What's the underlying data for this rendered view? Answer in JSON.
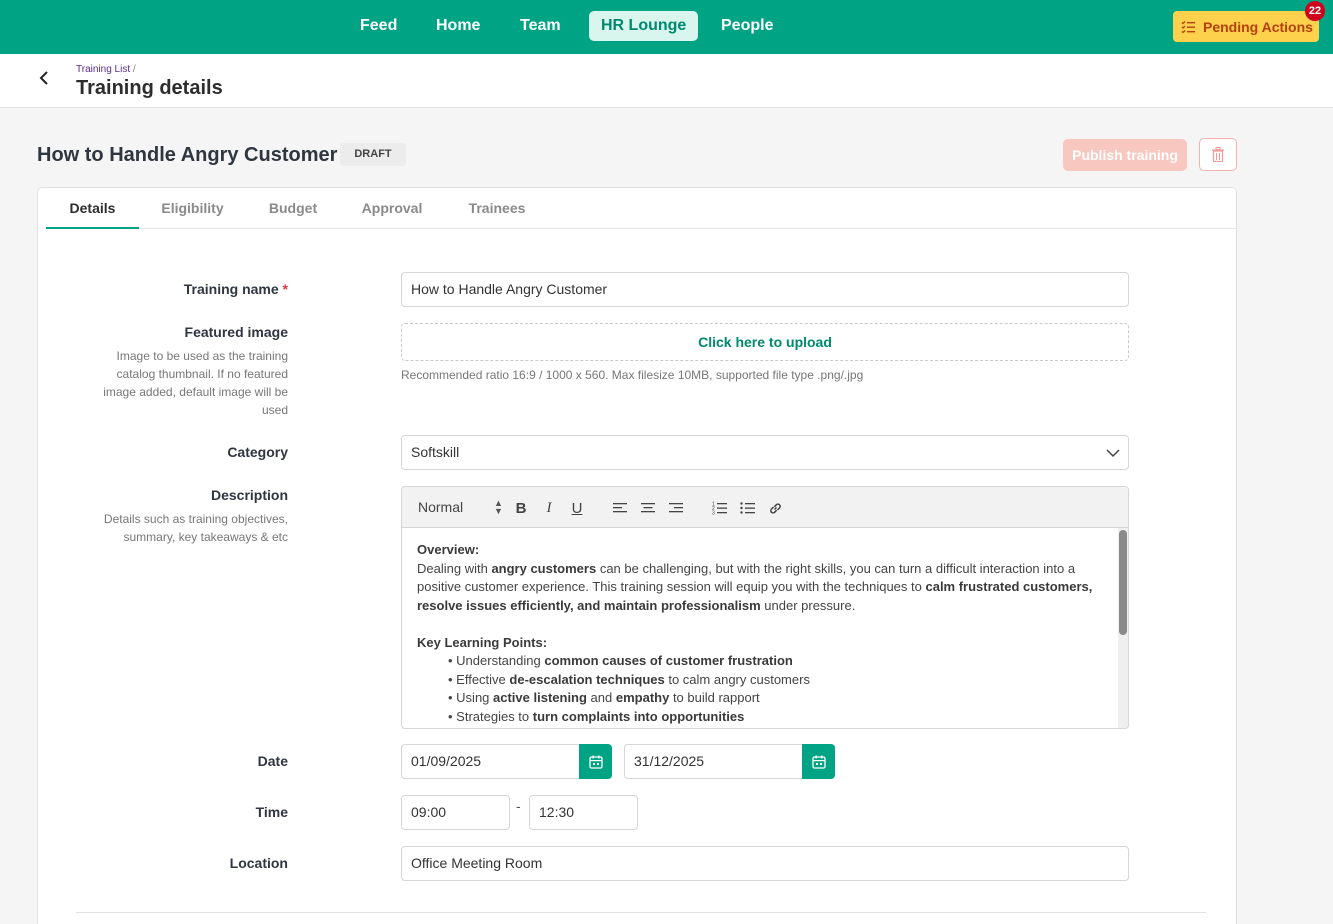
{
  "nav": {
    "items": [
      "Feed",
      "Home",
      "Team",
      "HR Lounge",
      "People"
    ],
    "active": "HR Lounge",
    "pending_label": "Pending Actions",
    "pending_count": "22",
    "pending_icon": "checklist-icon",
    "accent_color": "#00a383"
  },
  "header": {
    "breadcrumb": "Training List",
    "breadcrumb_sep": "/",
    "title": "Training details",
    "back_icon": "chevron-left-icon"
  },
  "training": {
    "title": "How to Handle Angry Customer",
    "status": "DRAFT",
    "publish_label": "Publish training",
    "delete_icon": "trash-icon"
  },
  "tabs": [
    "Details",
    "Eligibility",
    "Budget",
    "Approval",
    "Trainees"
  ],
  "active_tab": "Details",
  "form": {
    "name_label": "Training name",
    "required_mark": "*",
    "name_value": "How to Handle Angry Customer",
    "image_label": "Featured image",
    "image_help": "Image to be used as the training catalog thumbnail. If no featured image added, default image will be used",
    "upload_label": "Click here to upload",
    "upload_hint": "Recommended ratio 16:9 / 1000 x 560. Max filesize 10MB, supported file type .png/.jpg",
    "category_label": "Category",
    "category_value": "Softskill",
    "description_label": "Description",
    "description_help": "Details such as training objectives, summary, key takeaways & etc",
    "date_label": "Date",
    "date_start": "01/09/2025",
    "date_end": "31/12/2025",
    "time_label": "Time",
    "time_start": "09:00",
    "time_sep": "-",
    "time_end": "12:30",
    "location_label": "Location",
    "location_value": "Office Meeting Room"
  },
  "editor": {
    "format": "Normal",
    "toolbar_icons": [
      "bold-icon",
      "italic-icon",
      "underline-icon",
      "align-left-icon",
      "align-center-icon",
      "align-right-icon",
      "ordered-list-icon",
      "bullet-list-icon",
      "link-icon"
    ],
    "overview_heading": "Overview:",
    "p1_a": "Dealing with ",
    "p1_b": "angry customers",
    "p1_c": " can be challenging, but with the right skills, you can turn a difficult interaction into a positive customer experience. This training session will equip you with the techniques to ",
    "p1_d": "calm frustrated customers, resolve issues efficiently, and maintain professionalism",
    "p1_e": " under pressure.",
    "points_heading": "Key Learning Points:",
    "points": [
      {
        "pre": "• Understanding ",
        "bold": "common causes of customer frustration",
        "post": ""
      },
      {
        "pre": "• Effective ",
        "bold": "de-escalation techniques",
        "post": " to calm angry customers"
      },
      {
        "pre": "• Using ",
        "bold": "active listening",
        "post": " and ",
        "bold2": "empathy",
        "post2": " to build rapport"
      },
      {
        "pre": "• Strategies to ",
        "bold": "turn complaints into opportunities",
        "post": ""
      }
    ]
  }
}
